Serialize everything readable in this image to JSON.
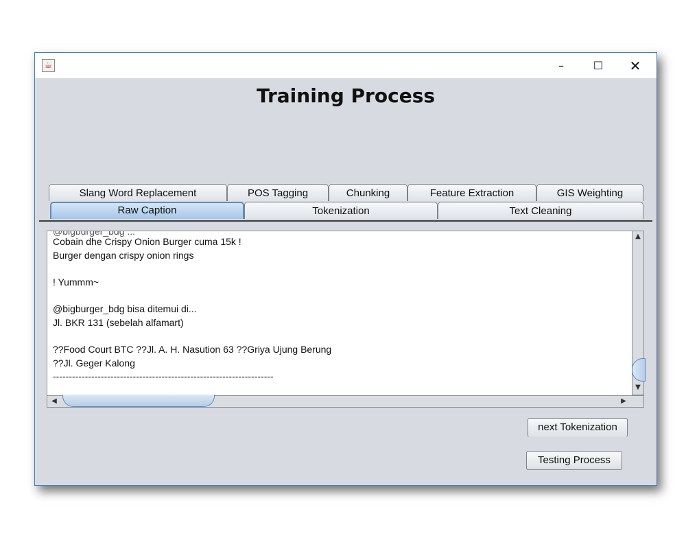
{
  "window": {
    "title_bar_text": "",
    "icon": "java-cup-icon",
    "controls": {
      "minimize": "–",
      "maximize": "☐",
      "close": "✕"
    }
  },
  "header": {
    "title": "Training Process"
  },
  "tabs": {
    "row_back": [
      "Slang Word Replacement",
      "POS Tagging",
      "Chunking",
      "Feature Extraction",
      "GIS Weighting"
    ],
    "row_front": [
      "Raw Caption",
      "Tokenization",
      "Text Cleaning"
    ],
    "selected": "Raw Caption"
  },
  "content": {
    "lines": [
      "Cobain dhe Crispy Onion Burger cuma 15k !",
      "Burger dengan crispy onion rings",
      "",
      "! Yummm~",
      "",
      "@bigburger_bdg bisa ditemui di...",
      "Jl. BKR 131 (sebelah alfamart)",
      "",
      "??Food Court BTC ??Jl. A. H. Nasution 63 ??Griya Ujung Berung",
      "??Jl. Geger Kalong",
      "---------------------------------------------------------------------"
    ],
    "cut_off_top_line": "@bigburger_bdg ..."
  },
  "buttons": {
    "next": "next Tokenization",
    "testing": "Testing Process"
  },
  "colors": {
    "accent": "#5e8cc0",
    "window_bg": "#d7dbe1",
    "border": "#3d7fc4"
  }
}
